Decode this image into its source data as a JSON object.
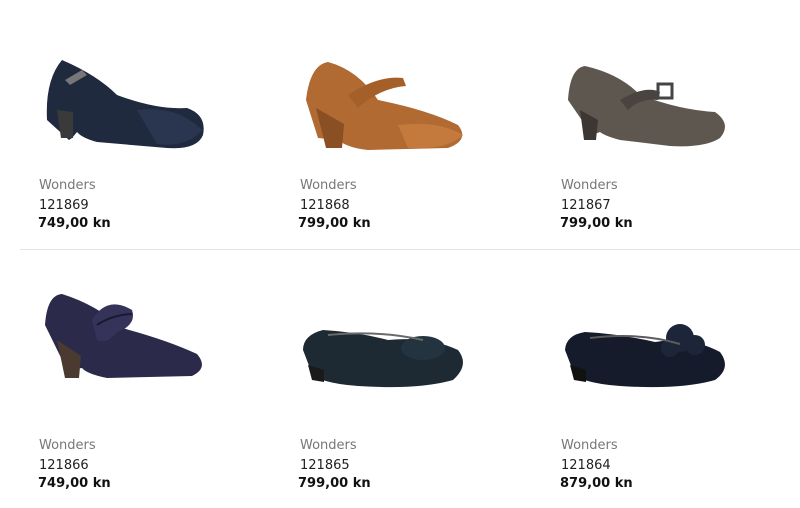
{
  "products": [
    {
      "brand": "Wonders",
      "code": "121869",
      "price": "749,00 kn",
      "colors": {
        "upper": "#1f2a3f",
        "toe": "#2a3650",
        "heel": "#3a3a3a",
        "strap": "#2f3d57"
      }
    },
    {
      "brand": "Wonders",
      "code": "121868",
      "price": "799,00 kn",
      "colors": {
        "upper": "#b06a32",
        "toe": "#c57a3d",
        "heel": "#8a4f22",
        "strap": "#a5602a"
      }
    },
    {
      "brand": "Wonders",
      "code": "121867",
      "price": "799,00 kn",
      "colors": {
        "upper": "#5d5750",
        "toe": "#6a625a",
        "heel": "#3c3733",
        "strap": "#4a4440"
      }
    },
    {
      "brand": "Wonders",
      "code": "121866",
      "price": "749,00 kn",
      "colors": {
        "upper": "#2b2a4a",
        "toe": "#35335a",
        "heel": "#4a3a30",
        "strap": "#2b2a4a"
      }
    },
    {
      "brand": "Wonders",
      "code": "121865",
      "price": "799,00 kn",
      "colors": {
        "upper": "#1d2a33",
        "toe": "#233440",
        "heel": "#1a1a1a",
        "strap": "#1d2a33"
      }
    },
    {
      "brand": "Wonders",
      "code": "121864",
      "price": "879,00 kn",
      "colors": {
        "upper": "#151b2b",
        "toe": "#1d2538",
        "heel": "#111",
        "strap": "#151b2b"
      }
    }
  ]
}
